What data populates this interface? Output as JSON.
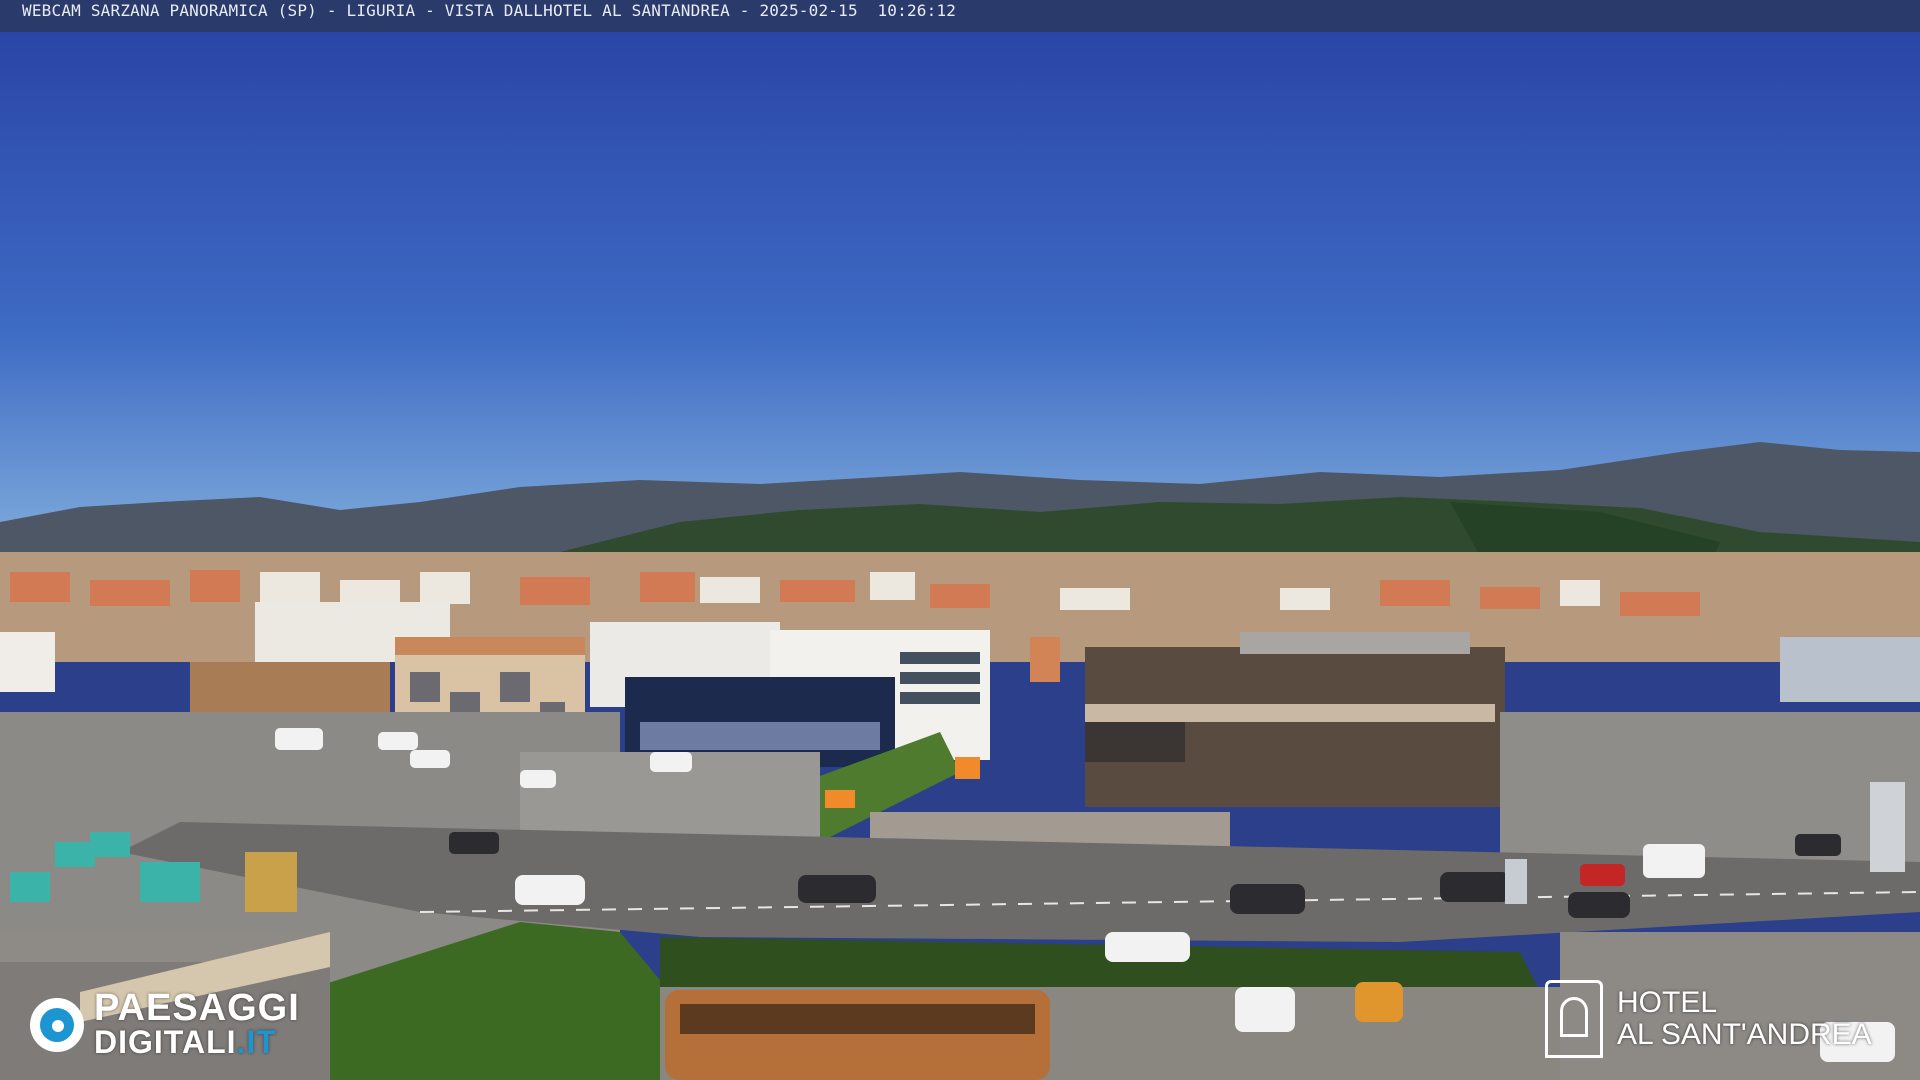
{
  "overlay": {
    "caption": "WEBCAM SARZANA PANORAMICA (SP) - LIGURIA - VISTA DALLHOTEL AL SANTANDREA - 2025-02-15  10:26:12"
  },
  "logos": {
    "paesaggi_line1": "PAESAGGI",
    "paesaggi_line2_main": "DIGITALI",
    "paesaggi_line2_tld": ".IT",
    "hotel_line1": "HOTEL",
    "hotel_line2": "AL SANT'ANDREA"
  },
  "colors": {
    "sky_top": "#2b45a8",
    "sky_bottom": "#6d9bd8",
    "mountains": "#4a5563",
    "overlay_bar": "#2a3a6b",
    "brand_blue": "#1d95d0"
  }
}
